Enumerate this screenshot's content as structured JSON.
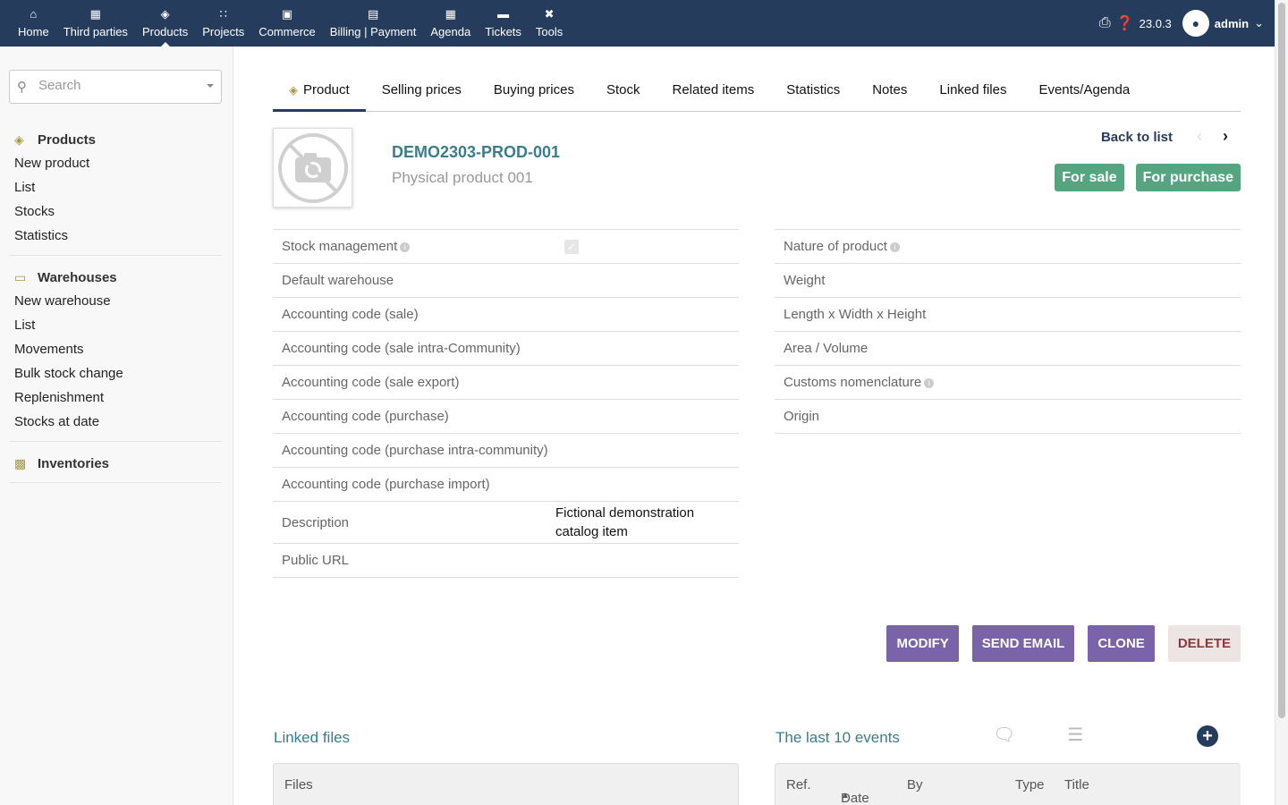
{
  "topnav": {
    "items": [
      {
        "label": "Home",
        "icon": "home-icon"
      },
      {
        "label": "Third parties",
        "icon": "building-icon"
      },
      {
        "label": "Products",
        "icon": "cube-icon",
        "active": true
      },
      {
        "label": "Projects",
        "icon": "project-icon"
      },
      {
        "label": "Commerce",
        "icon": "briefcase-icon"
      },
      {
        "label": "Billing | Payment",
        "icon": "invoice-icon"
      },
      {
        "label": "Agenda",
        "icon": "calendar-icon"
      },
      {
        "label": "Tickets",
        "icon": "ticket-icon"
      },
      {
        "label": "Tools",
        "icon": "tools-icon"
      }
    ],
    "version": "23.0.3",
    "user": "admin"
  },
  "sidebar": {
    "search_placeholder": "Search",
    "products": {
      "title": "Products",
      "links": [
        "New product",
        "List",
        "Stocks",
        "Statistics"
      ]
    },
    "warehouses": {
      "title": "Warehouses",
      "links": [
        "New warehouse",
        "List",
        "Movements",
        "Bulk stock change",
        "Replenishment",
        "Stocks at date"
      ]
    },
    "inventories": {
      "title": "Inventories"
    }
  },
  "tabs": [
    "Product",
    "Selling prices",
    "Buying prices",
    "Stock",
    "Related items",
    "Statistics",
    "Notes",
    "Linked files",
    "Events/Agenda"
  ],
  "product": {
    "ref": "DEMO2303-PROD-001",
    "label": "Physical product 001",
    "back_to_list": "Back to list",
    "badge_sale": "For sale",
    "badge_purchase": "For purchase"
  },
  "left_fields": [
    "Stock management",
    "Default warehouse",
    "Accounting code (sale)",
    "Accounting code (sale intra-Community)",
    "Accounting code (sale export)",
    "Accounting code (purchase)",
    "Accounting code (purchase intra-community)",
    "Accounting code (purchase import)",
    "Description",
    "Public URL"
  ],
  "description_value": "Fictional demonstration catalog item",
  "right_fields": [
    "Nature of product",
    "Weight",
    "Length x Width x Height",
    "Area / Volume",
    "Customs nomenclature",
    "Origin"
  ],
  "actions": {
    "modify": "MODIFY",
    "send_email": "SEND EMAIL",
    "clone": "CLONE",
    "delete": "DELETE"
  },
  "linked_files": {
    "title": "Linked files",
    "column": "Files"
  },
  "events": {
    "title": "The last 10 events",
    "columns": [
      "Ref.",
      "Date",
      "By",
      "Type",
      "Title"
    ]
  },
  "colors": {
    "topbar": "#263c5c",
    "link": "#3a7d8c",
    "badge": "#55a580",
    "button": "#7a63a8"
  }
}
